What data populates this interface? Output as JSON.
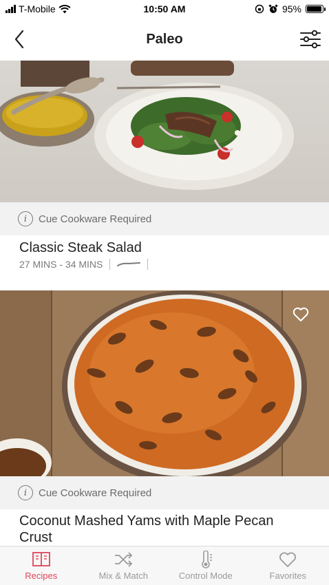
{
  "status_bar": {
    "carrier": "T-Mobile",
    "time": "10:50 AM",
    "battery": "95%",
    "battery_level": 0.95
  },
  "nav": {
    "title": "Paleo",
    "back_icon": "chevron-left-icon",
    "filter_icon": "sliders-icon"
  },
  "recipes": [
    {
      "cue_label": "Cue Cookware Required",
      "title": "Classic Steak Salad",
      "time": "27 MINS - 34 MINS",
      "cookware_icon": "pan-icon"
    },
    {
      "cue_label": "Cue Cookware Required",
      "title": "Coconut Mashed Yams with Maple Pecan Crust",
      "favorite_icon": "heart-outline-icon"
    }
  ],
  "tabs": [
    {
      "label": "Recipes",
      "icon": "book-icon",
      "active": true
    },
    {
      "label": "Mix & Match",
      "icon": "shuffle-icon",
      "active": false
    },
    {
      "label": "Control Mode",
      "icon": "thermometer-icon",
      "active": false
    },
    {
      "label": "Favorites",
      "icon": "heart-icon",
      "active": false
    }
  ],
  "colors": {
    "accent": "#e0445a",
    "banner_bg": "#f2f2f2",
    "muted_text": "#7a7a7a"
  }
}
